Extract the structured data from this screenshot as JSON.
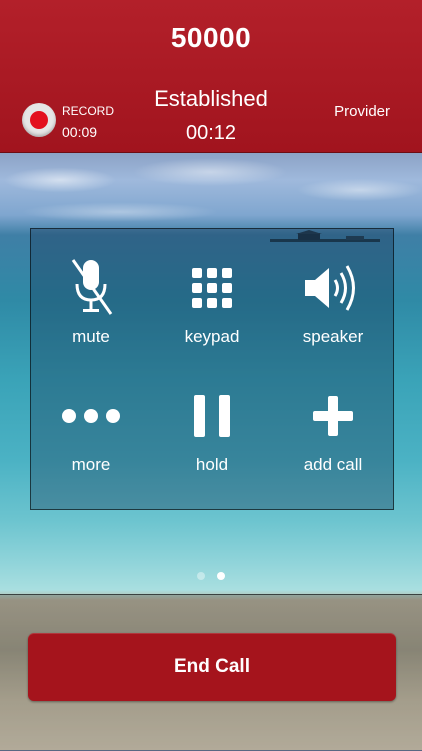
{
  "call": {
    "number": "50000",
    "status": "Established",
    "duration": "00:12",
    "provider": "Provider"
  },
  "record": {
    "label": "RECORD",
    "time": "00:09"
  },
  "controls": [
    {
      "label": "mute",
      "icon": "mic-off-icon"
    },
    {
      "label": "keypad",
      "icon": "keypad-icon"
    },
    {
      "label": "speaker",
      "icon": "speaker-icon"
    },
    {
      "label": "more",
      "icon": "more-dots-icon"
    },
    {
      "label": "hold",
      "icon": "pause-icon"
    },
    {
      "label": "add call",
      "icon": "plus-icon"
    }
  ],
  "pager": {
    "pages": 2,
    "active": 2
  },
  "end_call": {
    "label": "End Call"
  },
  "colors": {
    "header": "#b3202a",
    "end_call": "#a5141c",
    "record_dot": "#e3101e"
  }
}
